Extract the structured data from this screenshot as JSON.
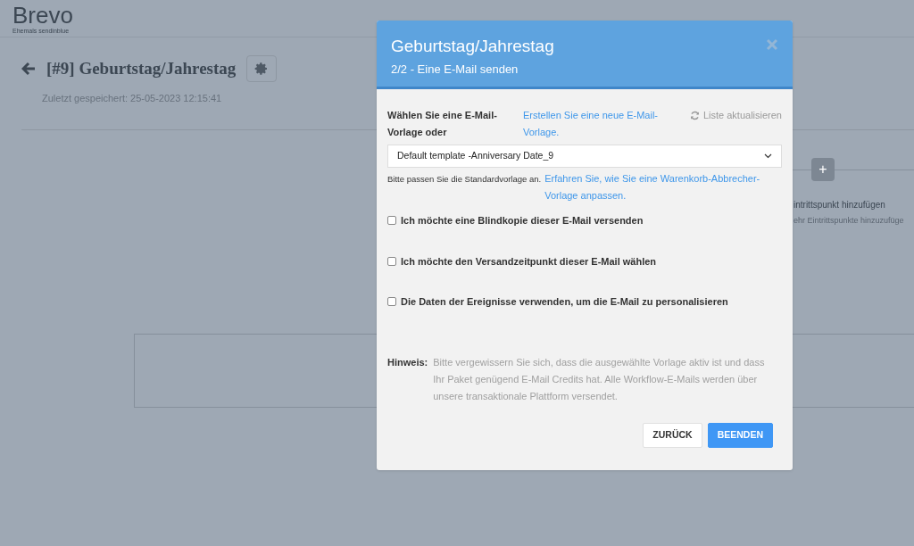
{
  "app": {
    "logo": "Brevo",
    "logo_tagline": "Ehemals sendinblue"
  },
  "workflow": {
    "title": "[#9] Geburtstag/Jahrestag",
    "last_saved": "Zuletzt gespeichert: 25-05-2023 12:15:41"
  },
  "canvas": {
    "entry_add_label": "+",
    "entry_title": "intrittspunkt hinzufügen",
    "entry_hint": "ehr Eintrittspunkte hinzuzufüge"
  },
  "dialog": {
    "title": "Geburtstag/Jahrestag",
    "subtitle": "2/2 - Eine E-Mail senden",
    "template_label": "Wählen Sie eine E-Mail-Vorlage oder",
    "create_link": "Erstellen Sie eine neue E-Mail-Vorlage.",
    "refresh_label": "Liste aktualisieren",
    "template_select": {
      "value": "Default template -Anniversary Date_9"
    },
    "help_text": "Bitte passen Sie die Standardvorlage an.",
    "help_link": "Erfahren Sie, wie Sie eine Warenkorb-Abbrecher-Vorlage anpassen.",
    "options": [
      {
        "label": "Ich möchte eine Blindkopie dieser E-Mail versenden",
        "checked": false
      },
      {
        "label": "Ich möchte den Versandzeitpunkt dieser E-Mail wählen",
        "checked": false
      },
      {
        "label": "Die Daten der Ereignisse verwenden, um die E-Mail zu personalisieren",
        "checked": false
      }
    ],
    "note_label": "Hinweis:",
    "note_text": "Bitte vergewissern Sie sich, dass die ausgewählte Vorlage aktiv ist und dass Ihr Paket genügend E-Mail Credits hat. Alle Workflow-E-Mails werden über unsere transaktionale Plattform versendet.",
    "buttons": [
      {
        "label": "ZURÜCK",
        "kind": "secondary"
      },
      {
        "label": "BEENDEN",
        "kind": "primary"
      }
    ]
  }
}
